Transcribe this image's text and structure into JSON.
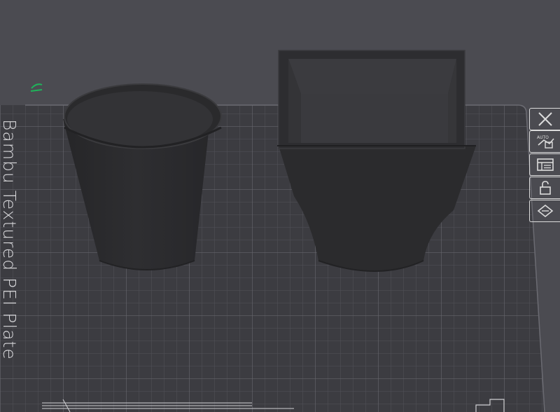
{
  "plate": {
    "label": "Bambu Textured PEI Plate"
  },
  "colors": {
    "background": "#4b4b51",
    "plate": "#3c3c41",
    "grid_line": "#5a5a61",
    "model": "#2c2c2e",
    "accent": "#1fb35a"
  },
  "icons": {
    "edit": "pencil-icon",
    "close": "close-icon",
    "auto_arrange": "auto-arrange-icon",
    "plate_settings": "plate-settings-icon",
    "lock": "lock-icon",
    "orient": "orient-icon"
  }
}
